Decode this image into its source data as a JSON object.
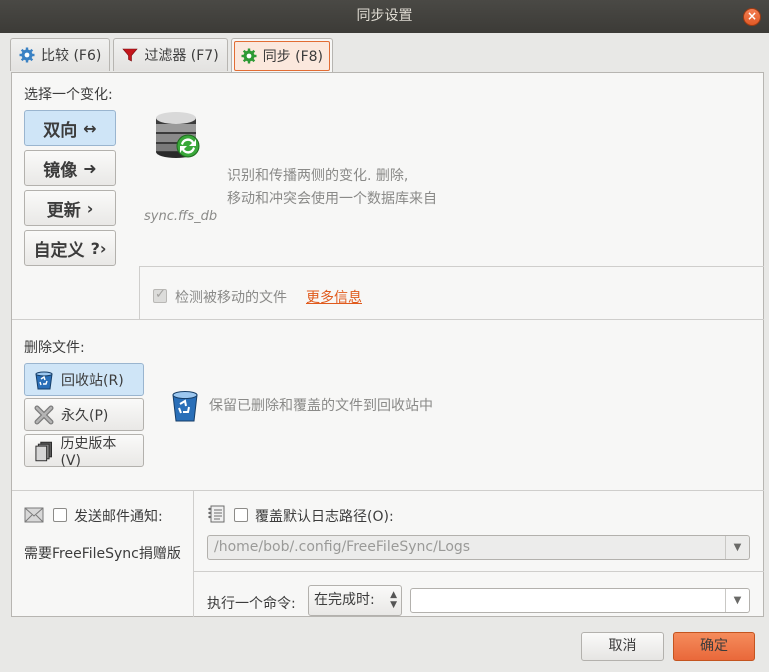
{
  "window": {
    "title": "同步设置",
    "close_label": "×"
  },
  "tabs": [
    {
      "label": "比较 (F6)",
      "icon": "gear-blue-icon"
    },
    {
      "label": "过滤器 (F7)",
      "icon": "filter-icon"
    },
    {
      "label": "同步 (F8)",
      "icon": "gear-green-icon",
      "active": true
    }
  ],
  "variant": {
    "heading": "选择一个变化:",
    "buttons": [
      {
        "label": "双向",
        "arrow": "↔",
        "selected": true
      },
      {
        "label": "镜像",
        "arrow": "➜",
        "selected": false
      },
      {
        "label": "更新",
        "arrow": "›",
        "selected": false
      },
      {
        "label": "自定义",
        "arrow": "?›",
        "selected": false
      }
    ],
    "db_file_label": "sync.ffs_db",
    "description_line1": "识别和传播两侧的变化. 删除,",
    "description_line2": "移动和冲突会使用一个数据库来自",
    "detect_moved_label": "检测被移动的文件",
    "detect_moved_checked": true,
    "more_info_label": "更多信息"
  },
  "deletion": {
    "heading": "删除文件:",
    "buttons": [
      {
        "label": "回收站(R)",
        "icon": "recycle-bin-icon",
        "selected": true
      },
      {
        "label": "永久(P)",
        "icon": "delete-x-icon",
        "selected": false
      },
      {
        "label": "历史版本(V)",
        "icon": "versioning-icon",
        "selected": false
      }
    ],
    "description": "保留已删除和覆盖的文件到回收站中"
  },
  "email": {
    "label": "发送邮件通知:",
    "checked": false,
    "donation_note": "需要FreeFileSync捐赠版"
  },
  "log": {
    "label": "覆盖默认日志路径(O):",
    "checked": false,
    "path_value": "/home/bob/.config/FreeFileSync/Logs"
  },
  "command": {
    "label": "执行一个命令:",
    "when_value": "在完成时:",
    "command_value": ""
  },
  "footer": {
    "cancel_label": "取消",
    "ok_label": "确定"
  },
  "colors": {
    "accent": "#e9683a",
    "selection": "#cfe5f7",
    "link": "#e05a1c"
  }
}
